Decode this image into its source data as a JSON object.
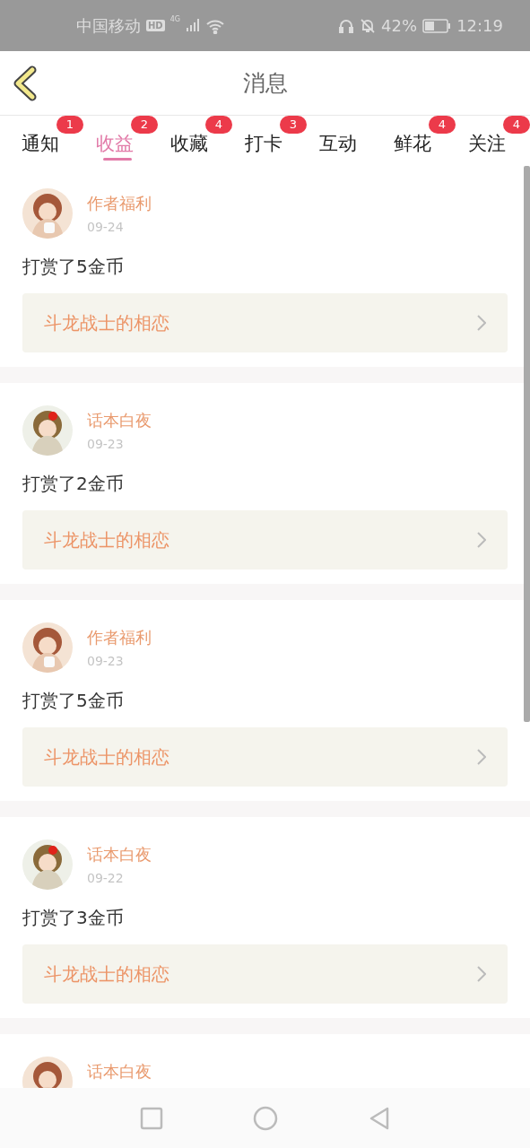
{
  "status_bar": {
    "carrier": "中国移动",
    "hd": "HD",
    "network": "4G",
    "battery": "42%",
    "time": "12:19"
  },
  "header": {
    "title": "消息"
  },
  "tabs": [
    {
      "label": "通知",
      "badge": "1",
      "selected": false
    },
    {
      "label": "收益",
      "badge": "2",
      "selected": true
    },
    {
      "label": "收藏",
      "badge": "4",
      "selected": false
    },
    {
      "label": "打卡",
      "badge": "3",
      "selected": false
    },
    {
      "label": "互动",
      "selected": false
    },
    {
      "label": "鲜花",
      "badge": "4",
      "selected": false
    },
    {
      "label": "关注",
      "badge": "4",
      "selected": false
    }
  ],
  "messages": [
    {
      "name": "作者福利",
      "date": "09-24",
      "text": "打赏了5金币",
      "book": "斗龙战士的相恋"
    },
    {
      "name": "话本白夜",
      "date": "09-23",
      "text": "打赏了2金币",
      "book": "斗龙战士的相恋"
    },
    {
      "name": "作者福利",
      "date": "09-23",
      "text": "打赏了5金币",
      "book": "斗龙战士的相恋"
    },
    {
      "name": "话本白夜",
      "date": "09-22",
      "text": "打赏了3金币",
      "book": "斗龙战士的相恋"
    },
    {
      "name": "话本白夜"
    }
  ]
}
